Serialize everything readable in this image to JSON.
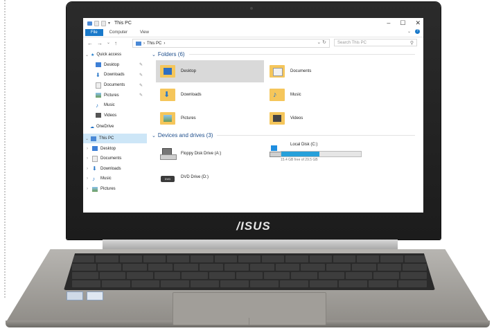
{
  "window": {
    "title": "This PC",
    "minimize": "–",
    "maximize": "☐",
    "close": "✕"
  },
  "ribbon": {
    "tabs": [
      "File",
      "Computer",
      "View"
    ]
  },
  "address": {
    "path": "This PC",
    "separator": "›",
    "search_placeholder": "Search This PC"
  },
  "nav": {
    "quick_access": "Quick access",
    "quick_items": [
      "Desktop",
      "Downloads",
      "Documents",
      "Pictures",
      "Music",
      "Videos"
    ],
    "onedrive": "OneDrive",
    "this_pc": "This PC",
    "pc_items": [
      "Desktop",
      "Documents",
      "Downloads",
      "Music",
      "Pictures"
    ]
  },
  "content": {
    "folders_header": "Folders (6)",
    "folders": [
      "Desktop",
      "Documents",
      "Downloads",
      "Music",
      "Pictures",
      "Videos"
    ],
    "devices_header": "Devices and drives (3)",
    "floppy": "Floppy Disk Drive (A:)",
    "local_disk": "Local Disk (C:)",
    "local_disk_free": "15.4 GB free of 29.5 GB",
    "local_disk_used_fraction": 0.48,
    "dvd": "DVD Drive (D:)"
  },
  "laptop": {
    "brand": "/ISUS"
  },
  "colors": {
    "accent": "#1979ca",
    "folder": "#f5c65b",
    "selection": "#cde6f7",
    "disk_bar": "#26a0da"
  }
}
